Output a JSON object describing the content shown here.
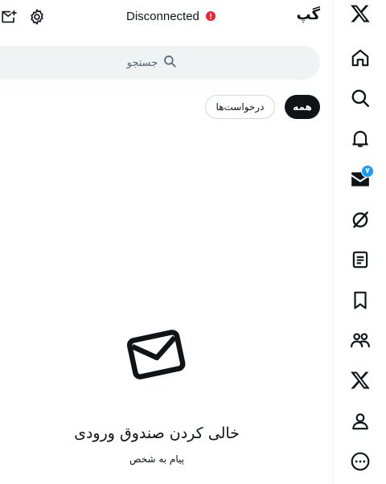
{
  "header": {
    "title": "گپ",
    "connection_status": "Disconnected",
    "status_color": "#f4212e"
  },
  "search": {
    "placeholder": "جستجو"
  },
  "filters": {
    "all_label": "همه",
    "requests_label": "درخواست‌ها"
  },
  "empty_state": {
    "title": "خالی کردن صندوق ورودی",
    "action_label": "پیام به شخص"
  },
  "rail": {
    "messages_badge": "۷",
    "icons": [
      "x-logo-icon",
      "home-icon",
      "search-icon",
      "bell-icon",
      "mail-icon",
      "grok-icon",
      "list-icon",
      "bookmark-icon",
      "communities-icon",
      "premium-x-icon",
      "profile-icon",
      "more-icon"
    ]
  },
  "colors": {
    "accent": "#1d9bf0",
    "text": "#0f1419",
    "muted": "#536471",
    "search_bg": "#eff3f4",
    "alert": "#f4212e"
  }
}
